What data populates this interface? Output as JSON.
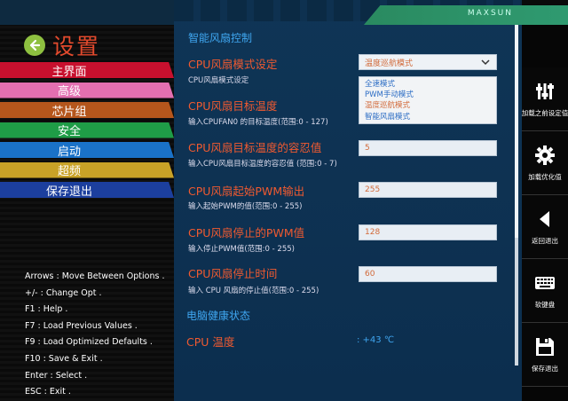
{
  "header": {
    "brand": "MAXSUN"
  },
  "left": {
    "title": "设置",
    "menu": [
      {
        "label": "主界面",
        "color": "#c8102e"
      },
      {
        "label": "高级",
        "color": "#e36fb0"
      },
      {
        "label": "芯片组",
        "color": "#b5561c"
      },
      {
        "label": "安全",
        "color": "#1f9d47"
      },
      {
        "label": "启动",
        "color": "#1a72c8"
      },
      {
        "label": "超频",
        "color": "#c9a227"
      },
      {
        "label": "保存退出",
        "color": "#1c3f9e"
      }
    ],
    "help": [
      "Arrows : Move Between Options .",
      "+/- : Change Opt .",
      "F1 : Help .",
      "F7 : Load Previous Values .",
      "F9 : Load Optimized Defaults .",
      "F10 : Save & Exit .",
      "Enter : Select .",
      "ESC : Exit ."
    ]
  },
  "main": {
    "section_title": "智能风扇控制",
    "mode": {
      "title": "CPU风扇模式设定",
      "desc": "CPU风扇模式设定",
      "selected": "温度巡航模式",
      "options": [
        "全速模式",
        "PWM手动模式",
        "温度巡航模式",
        "智能风扇模式"
      ]
    },
    "target_temp": {
      "title": "CPU风扇目标温度",
      "desc": "输入CPUFAN0 的目标温度(范围:0 - 127)"
    },
    "tolerance": {
      "title": "CPU风扇目标温度的容忍值",
      "desc": "输入CPU风扇目标温度的容忍值 (范围:0 - 7)",
      "value": "5"
    },
    "start_pwm": {
      "title": "CPU风扇起始PWM输出",
      "desc": "输入起始PWM的值(范围:0 - 255)",
      "value": "255"
    },
    "stop_pwm": {
      "title": "CPU风扇停止的PWM值",
      "desc": "输入停止PWM值(范围:0 - 255)",
      "value": "128"
    },
    "stop_time": {
      "title": "CPU风扇停止时间",
      "desc": "输入 CPU 风扇的停止值(范围:0 - 255)",
      "value": "60"
    },
    "health_title": "电脑健康状态",
    "cpu_temp": {
      "label": "CPU 温度",
      "value": ": +43 ℃"
    }
  },
  "toolbar": {
    "items": [
      {
        "label": "加载之前设定值",
        "icon": "sliders-icon"
      },
      {
        "label": "加载优化值",
        "icon": "gear-icon"
      },
      {
        "label": "返回退出",
        "icon": "back-arrow-icon"
      },
      {
        "label": "软键盘",
        "icon": "keyboard-icon"
      },
      {
        "label": "保存退出",
        "icon": "save-icon"
      }
    ]
  }
}
